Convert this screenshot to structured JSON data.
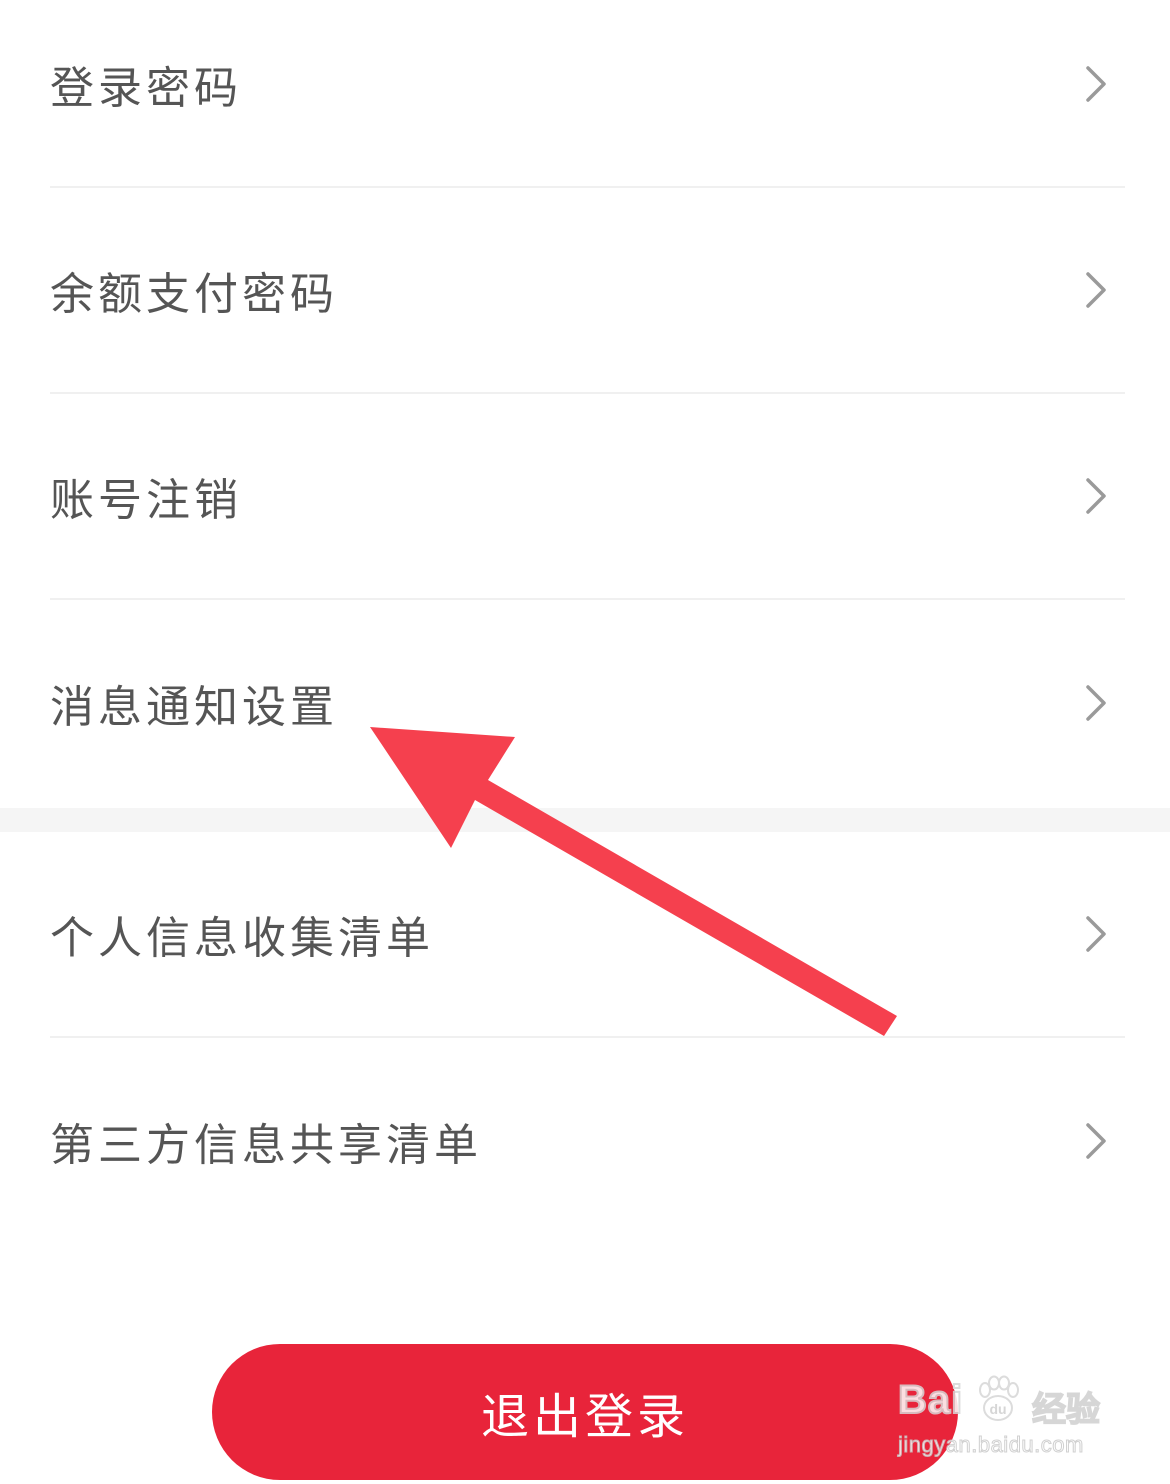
{
  "settings_list_1": [
    {
      "label": "登录密码"
    },
    {
      "label": "余额支付密码"
    },
    {
      "label": "账号注销"
    },
    {
      "label": "消息通知设置"
    }
  ],
  "settings_list_2": [
    {
      "label": "个人信息收集清单"
    },
    {
      "label": "第三方信息共享清单"
    }
  ],
  "logout_button": {
    "label": "退出登录"
  },
  "annotation": {
    "icon": "pointer-arrow",
    "color": "#f5404e"
  },
  "watermark": {
    "brand": "Bai",
    "brand_suffix": "du",
    "jingyan_text": "经验",
    "url": "jingyan.baidu.com"
  },
  "colors": {
    "accent": "#e8243a",
    "label": "#555555",
    "chevron": "#9a9a9a",
    "divider": "#f0f0f0",
    "group_gap": "#f5f5f5"
  }
}
